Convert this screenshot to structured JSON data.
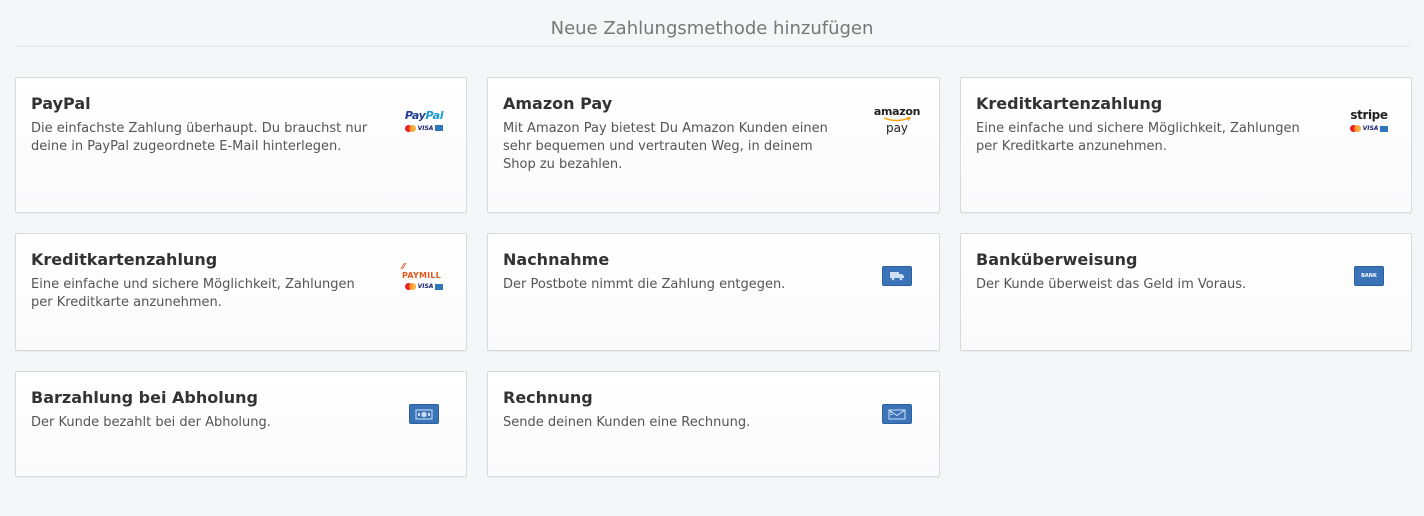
{
  "header": {
    "title": "Neue Zahlungsmethode hinzufügen"
  },
  "methods": [
    {
      "title": "PayPal",
      "description": "Die einfachste Zahlung überhaupt. Du brauchst nur deine in PayPal zugeordnete E-Mail hinterlegen.",
      "icon": "paypal-logo-icon",
      "logo_text": {
        "part1": "Pay",
        "part2": "Pal"
      },
      "card_text": "VISA"
    },
    {
      "title": "Amazon Pay",
      "description": "Mit Amazon Pay bietest Du Amazon Kunden einen sehr bequemen und vertrauten Weg, in deinem Shop zu bezahlen.",
      "icon": "amazon-pay-logo-icon",
      "logo_text": {
        "line1": "amazon",
        "line2": "pay"
      }
    },
    {
      "title": "Kreditkartenzahlung",
      "description": "Eine einfache und sichere Möglichkeit, Zahlungen per Kreditkarte anzunehmen.",
      "icon": "stripe-logo-icon",
      "logo_text": "stripe",
      "card_text": "VISA"
    },
    {
      "title": "Kreditkartenzahlung",
      "description": "Eine einfache und sichere Möglichkeit, Zahlungen per Kreditkarte anzunehmen.",
      "icon": "paymill-logo-icon",
      "logo_text": "PAYMILL",
      "card_text": "VISA"
    },
    {
      "title": "Nachnahme",
      "description": "Der Postbote nimmt die Zahlung entgegen.",
      "icon": "delivery-truck-icon"
    },
    {
      "title": "Banküberweisung",
      "description": "Der Kunde überweist das Geld im Voraus.",
      "icon": "bank-icon",
      "logo_text": "BANK"
    },
    {
      "title": "Barzahlung bei Abholung",
      "description": "Der Kunde bezahlt bei der Abholung.",
      "icon": "cash-icon"
    },
    {
      "title": "Rechnung",
      "description": "Sende deinen Kunden eine Rechnung.",
      "icon": "invoice-envelope-icon"
    }
  ],
  "colors": {
    "page_bg": "#f5f6f8",
    "card_border": "#d7d9dd",
    "icon_blue": "#3b73b9",
    "paypal_dark": "#1d3f8f",
    "paypal_light": "#179bd7",
    "paymill_orange": "#e05a1f"
  }
}
